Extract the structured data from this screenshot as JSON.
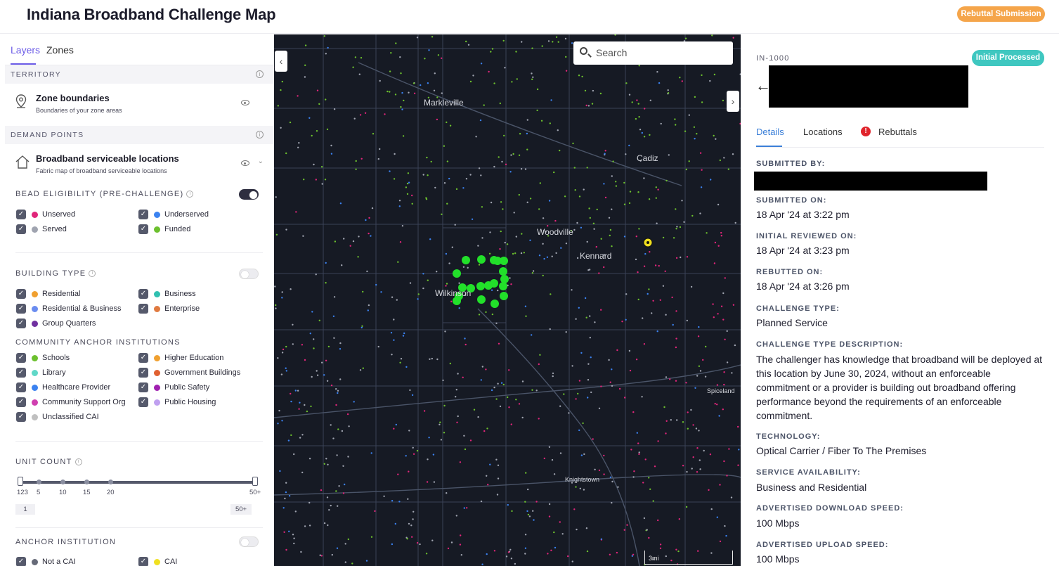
{
  "app": {
    "title": "Indiana Broadband Challenge Map",
    "rebuttal_button": "Rebuttal Submission"
  },
  "left_panel": {
    "tabs": [
      "Layers",
      "Zones"
    ],
    "territory": {
      "heading": "TERRITORY",
      "layer_title": "Zone boundaries",
      "layer_sub": "Boundaries of your zone areas"
    },
    "demand_points": {
      "heading": "DEMAND POINTS",
      "layer_title": "Broadband serviceable locations",
      "layer_sub": "Fabric map of broadband serviceable locations"
    },
    "bead_eligibility": {
      "label": "BEAD ELIGIBILITY (PRE-CHALLENGE)",
      "toggle_on": true,
      "items": [
        {
          "label": "Unserved",
          "color": "#e0257a"
        },
        {
          "label": "Underserved",
          "color": "#3b82f0"
        },
        {
          "label": "Served",
          "color": "#a0a4b0"
        },
        {
          "label": "Funded",
          "color": "#6cc02e"
        }
      ]
    },
    "building_type": {
      "label": "BUILDING TYPE",
      "toggle_on": false,
      "items": [
        {
          "label": "Residential",
          "color": "#f0a030"
        },
        {
          "label": "Business",
          "color": "#30c0b0"
        },
        {
          "label": "Residential & Business",
          "color": "#6a8cf0"
        },
        {
          "label": "Enterprise",
          "color": "#e07a40"
        },
        {
          "label": "Group Quarters",
          "color": "#7030a0"
        }
      ]
    },
    "community_anchor": {
      "label": "COMMUNITY ANCHOR INSTITUTIONS",
      "items": [
        {
          "label": "Schools",
          "color": "#6cc02e"
        },
        {
          "label": "Higher Education",
          "color": "#f0a030"
        },
        {
          "label": "Library",
          "color": "#60d8c8"
        },
        {
          "label": "Government Buildings",
          "color": "#e06030"
        },
        {
          "label": "Healthcare Provider",
          "color": "#3b82f0"
        },
        {
          "label": "Public Safety",
          "color": "#a020b0"
        },
        {
          "label": "Community Support Org",
          "color": "#d040b0"
        },
        {
          "label": "Public Housing",
          "color": "#c0a0f0"
        },
        {
          "label": "Unclassified CAI",
          "color": "#c0c0c0"
        }
      ]
    },
    "unit_count": {
      "label": "UNIT COUNT",
      "ticks": [
        "123",
        "5",
        "10",
        "15",
        "20",
        "50+"
      ],
      "range_min": "1",
      "range_max": "50+"
    },
    "anchor_institution": {
      "label": "ANCHOR INSTITUTION",
      "toggle_on": false,
      "items": [
        {
          "label": "Not a CAI",
          "color": "#666a78"
        },
        {
          "label": "CAI",
          "color": "#f0e020"
        }
      ]
    }
  },
  "map": {
    "search_placeholder": "Search",
    "places": [
      "Markleville",
      "Cadiz",
      "Woodville",
      "Kennard",
      "Wilkinson",
      "Spiceland",
      "Knightstown"
    ],
    "scale_label": "3mi"
  },
  "right_panel": {
    "id": "IN-1000",
    "status": "Initial Processed",
    "tabs": [
      "Details",
      "Locations",
      "Rebuttals"
    ],
    "fields": [
      {
        "label": "SUBMITTED BY:",
        "value": ""
      },
      {
        "label": "SUBMITTED ON:",
        "value": "18 Apr '24 at 3:22 pm"
      },
      {
        "label": "INITIAL REVIEWED ON:",
        "value": "18 Apr '24 at 3:23 pm"
      },
      {
        "label": "REBUTTED ON:",
        "value": "18 Apr '24 at 3:26 pm"
      },
      {
        "label": "CHALLENGE TYPE:",
        "value": "Planned Service"
      },
      {
        "label": "CHALLENGE TYPE DESCRIPTION:",
        "value": "The challenger has knowledge that broadband will be deployed at this location by June 30, 2024, without an enforceable commitment or a provider is building out broadband offering performance beyond the requirements of an enforceable commitment."
      },
      {
        "label": "TECHNOLOGY:",
        "value": "Optical Carrier / Fiber To The Premises"
      },
      {
        "label": "SERVICE AVAILABILITY:",
        "value": "Business and Residential"
      },
      {
        "label": "ADVERTISED DOWNLOAD SPEED:",
        "value": "100 Mbps"
      },
      {
        "label": "ADVERTISED UPLOAD SPEED:",
        "value": "100 Mbps"
      }
    ]
  }
}
